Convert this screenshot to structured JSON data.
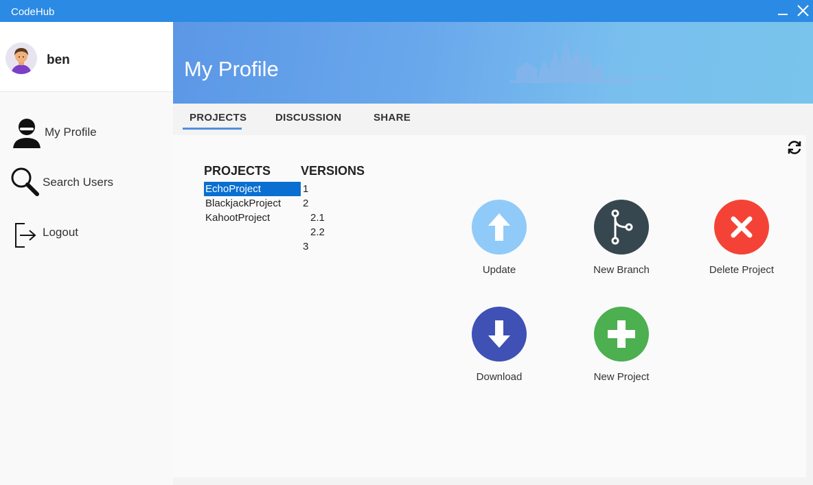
{
  "window": {
    "title": "CodeHub"
  },
  "user": {
    "name": "ben"
  },
  "sidebar": {
    "items": [
      {
        "label": "My Profile",
        "icon": "user-icon"
      },
      {
        "label": "Search Users",
        "icon": "search-icon"
      },
      {
        "label": "Logout",
        "icon": "logout-icon"
      }
    ]
  },
  "header": {
    "title": "My Profile"
  },
  "tabs": [
    {
      "label": "PROJECTS",
      "active": true
    },
    {
      "label": "DISCUSSION",
      "active": false
    },
    {
      "label": "SHARE",
      "active": false
    }
  ],
  "projects_panel": {
    "projects_header": "PROJECTS",
    "versions_header": "VERSIONS",
    "projects": [
      "EchoProject",
      "BlackjackProject",
      "KahootProject"
    ],
    "selected_project": "EchoProject",
    "versions": [
      "1",
      "2",
      "2.1",
      "2.2",
      "3"
    ]
  },
  "actions": [
    {
      "label": "Update",
      "icon": "arrow-up-icon",
      "color": "#90caf9"
    },
    {
      "label": "New Branch",
      "icon": "branch-icon",
      "color": "#37474f"
    },
    {
      "label": "Delete Project",
      "icon": "close-icon",
      "color": "#f44336"
    },
    {
      "label": "Download",
      "icon": "arrow-down-icon",
      "color": "#3f51b5"
    },
    {
      "label": "New Project",
      "icon": "plus-icon",
      "color": "#4caf50"
    }
  ],
  "colors": {
    "titlebar": "#2b8ae3",
    "selection": "#0a6fd1",
    "tab_accent": "#4f8ee0"
  }
}
